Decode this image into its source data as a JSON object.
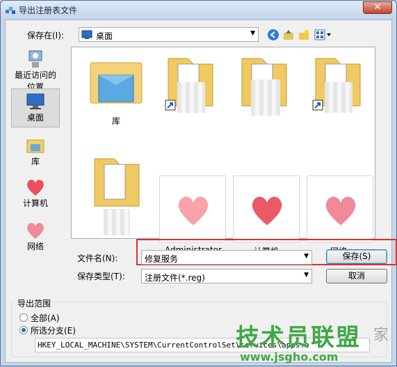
{
  "window": {
    "title": "导出注册表文件",
    "close_label": "✕"
  },
  "savein": {
    "label": "保存在(I):",
    "value": "桌面"
  },
  "places": [
    {
      "label": "最近访问的位置",
      "icon": "recent-places-icon"
    },
    {
      "label": "桌面",
      "icon": "desktop-icon",
      "selected": true
    },
    {
      "label": "库",
      "icon": "library-icon"
    },
    {
      "label": "计算机",
      "icon": "heart-icon"
    },
    {
      "label": "网络",
      "icon": "heart-icon"
    }
  ],
  "files": [
    {
      "label": "库",
      "icon": "library-folder-icon"
    },
    {
      "label": "",
      "icon": "folder-shortcut-icon"
    },
    {
      "label": "",
      "icon": "folder-icon"
    },
    {
      "label": "",
      "icon": "folder-shortcut-icon"
    },
    {
      "label": "",
      "icon": "folder-icon"
    },
    {
      "label": "Administrator",
      "icon": "heart-icon"
    },
    {
      "label": "计算机",
      "icon": "heart-icon"
    },
    {
      "label": "网络",
      "icon": "heart-icon"
    }
  ],
  "filename": {
    "label": "文件名(N):",
    "value": "修复服务"
  },
  "filetype": {
    "label": "保存类型(T):",
    "value": "注册文件(*.reg)"
  },
  "buttons": {
    "save": "保存(S)",
    "cancel": "取消"
  },
  "export_range": {
    "title": "导出范围",
    "all_label": "全部(A)",
    "branch_label": "所选分支(E)",
    "selected": "branch",
    "path": "HKEY_LOCAL_MACHINE\\SYSTEM\\CurrentControlSet\\services\\apps.e"
  },
  "watermark": {
    "title": "技术员联盟",
    "url": "www.jsgho.com",
    "side": "家"
  },
  "colors": {
    "highlight_box": "#d9302c",
    "watermark": "#3fa845"
  }
}
